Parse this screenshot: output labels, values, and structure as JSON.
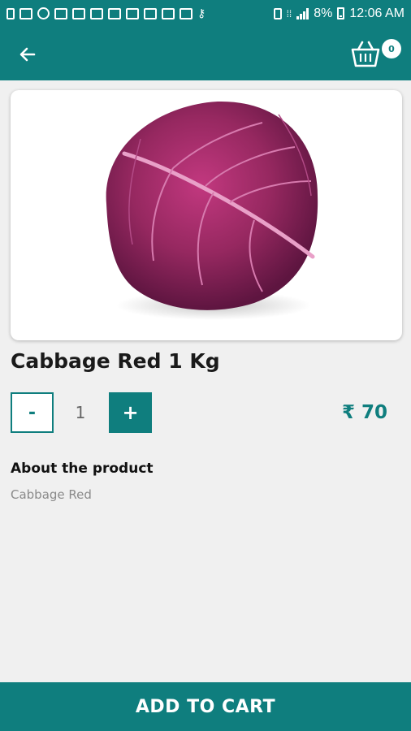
{
  "status_bar": {
    "battery": "8%",
    "time": "12:06 AM"
  },
  "header": {
    "back_icon": "arrow-left-icon",
    "cart_icon": "basket-icon",
    "cart_count": "0"
  },
  "product": {
    "image": "red-cabbage-photo",
    "title": "Cabbage Red 1 Kg",
    "quantity": "1",
    "minus_label": "-",
    "plus_label": "+",
    "currency": "₹",
    "price": "70",
    "about_heading": "About the product",
    "description": "Cabbage Red"
  },
  "footer": {
    "add_to_cart_label": "ADD TO CART"
  },
  "colors": {
    "primary": "#0f7e7e",
    "background": "#f0f0f0"
  }
}
